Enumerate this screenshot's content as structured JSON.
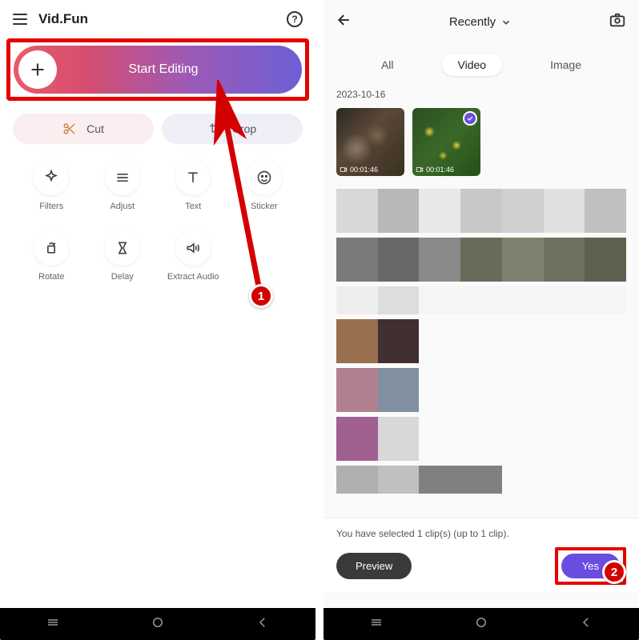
{
  "screen1": {
    "app_title": "Vid.Fun",
    "start_label": "Start Editing",
    "cut_label": "Cut",
    "crop_label": "Crop",
    "tools": {
      "filters": "Filters",
      "adjust": "Adjust",
      "text": "Text",
      "sticker": "Sticker",
      "rotate": "Rotate",
      "delay": "Delay",
      "extract_audio": "Extract Audio"
    },
    "badge": "1"
  },
  "screen2": {
    "dropdown_label": "Recently",
    "tabs": {
      "all": "All",
      "video": "Video",
      "image": "Image"
    },
    "date": "2023-10-16",
    "duration": "00:01:46",
    "footer_text": "You have selected 1 clip(s) (up to 1 clip).",
    "preview_label": "Preview",
    "yes_label": "Yes",
    "badge": "2"
  }
}
